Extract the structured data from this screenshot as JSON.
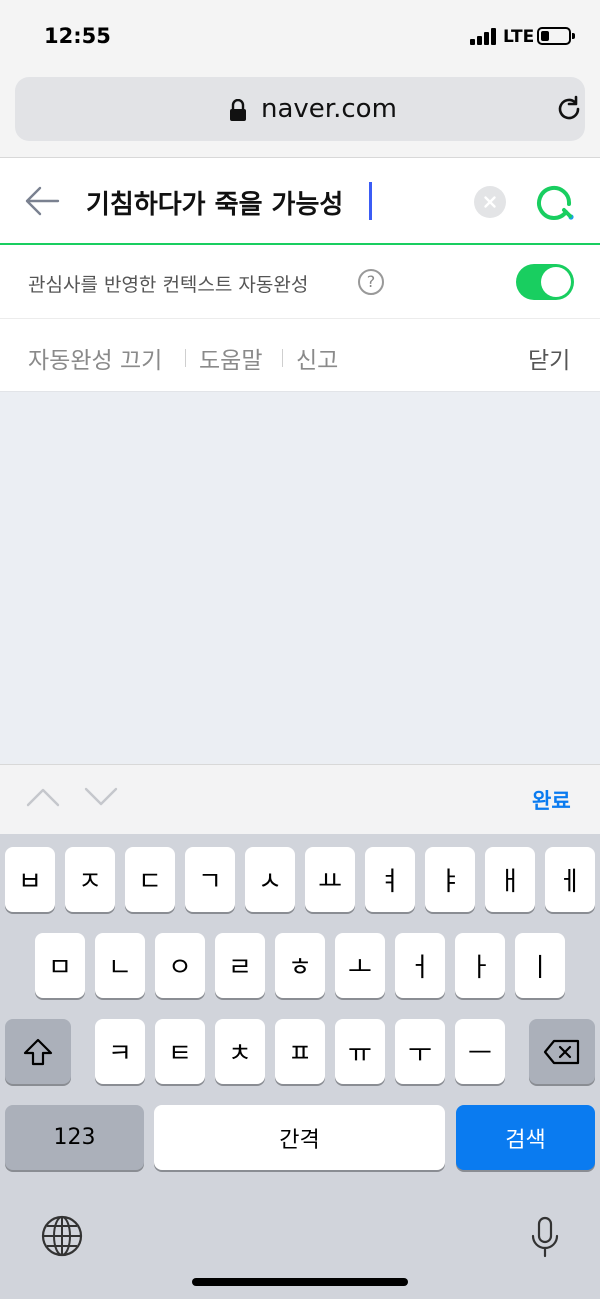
{
  "status": {
    "time": "12:55",
    "network": "LTE"
  },
  "browser": {
    "url": "naver.com"
  },
  "search": {
    "query": "기침하다가 죽을 가능성"
  },
  "context": {
    "label": "관심사를 반영한 컨텍스트 자동완성",
    "help": "?"
  },
  "options": {
    "disable": "자동완성 끄기",
    "help": "도움말",
    "report": "신고",
    "close": "닫기"
  },
  "accessory": {
    "done": "완료"
  },
  "keyboard": {
    "row1": [
      "ㅂ",
      "ㅈ",
      "ㄷ",
      "ㄱ",
      "ㅅ",
      "ㅛ",
      "ㅕ",
      "ㅑ",
      "ㅐ",
      "ㅔ"
    ],
    "row2": [
      "ㅁ",
      "ㄴ",
      "ㅇ",
      "ㄹ",
      "ㅎ",
      "ㅗ",
      "ㅓ",
      "ㅏ",
      "ㅣ"
    ],
    "row3": [
      "ㅋ",
      "ㅌ",
      "ㅊ",
      "ㅍ",
      "ㅠ",
      "ㅜ",
      "ㅡ"
    ],
    "numbers": "123",
    "space": "간격",
    "search": "검색"
  },
  "colors": {
    "accent": "#19ce60",
    "keyboard_blue": "#0a7bf0"
  }
}
